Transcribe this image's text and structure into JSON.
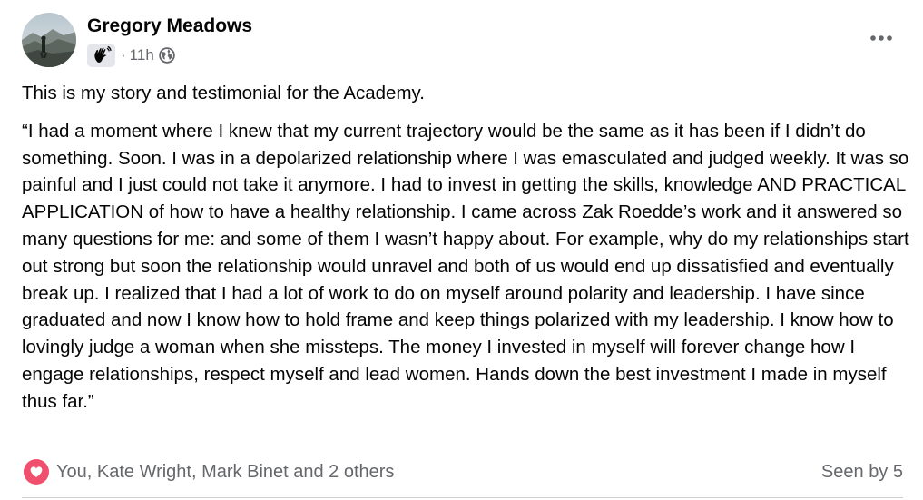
{
  "post": {
    "author": "Gregory Meadows",
    "time": "11h",
    "separator": "·",
    "icons": {
      "avatar": "mountain-landscape-avatar",
      "badge": "waving-hand-icon",
      "audience": "globe-icon",
      "more": "more-options-icon",
      "reaction": "heart-love-icon"
    },
    "intro": "This is my story and testimonial for the Academy.",
    "testimonial": "“I had a moment where I knew that my current trajectory would be the same as it has been if I didn’t do something. Soon. I was in a depolarized relationship where I was emasculated and judged weekly. It was so painful and I just could not take it anymore. I had to invest in getting the skills, knowledge AND PRACTICAL APPLICATION of how to have a healthy relationship. I came across Zak Roedde’s work and it answered so many questions for me: and some of them I wasn’t happy about. For example, why do my relationships start out strong but soon the relationship would unravel and both of us would end up dissatisfied and eventually break up. I realized that I had a lot of work to do on myself around polarity and leadership. I have since graduated and now I know how to hold frame and keep things polarized with my leadership. I know how to lovingly judge a woman when she missteps. The money I invested in myself will forever change how I engage relationships, respect myself and lead women. Hands down the best investment I made in myself thus far.”",
    "reactions_text": "You, Kate Wright, Mark Binet and 2 others",
    "seen_text": "Seen by 5"
  },
  "colors": {
    "primary_text": "#050505",
    "secondary_text": "#65676b",
    "love_reaction": "#f0506e",
    "badge_bg": "#e4e6eb",
    "divider": "#ced0d4"
  }
}
